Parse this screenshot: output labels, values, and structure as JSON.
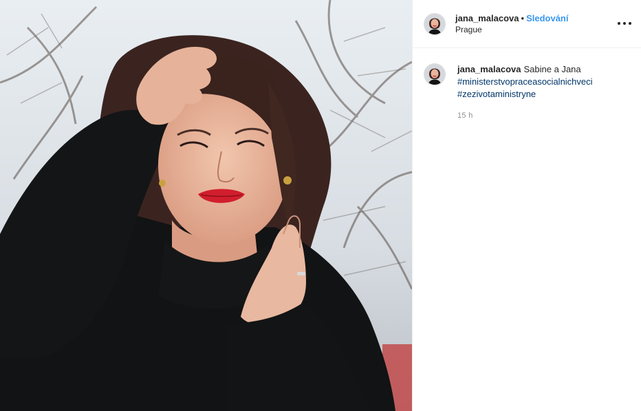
{
  "post": {
    "author": {
      "username": "jana_malacova",
      "separator": "•",
      "follow_label": "Sledování",
      "location": "Prague"
    },
    "more_icon": "more-options-icon",
    "caption": {
      "username": "jana_malacova",
      "text": "Sabine a Jana",
      "hashtags": [
        "#ministerstvopraceasocialnichveci",
        "#zezivotaministryne"
      ],
      "time": "15 h"
    }
  },
  "colors": {
    "accent": "#3897f0",
    "hashtag": "#003569",
    "muted": "#8e8e8e",
    "text": "#262626"
  }
}
